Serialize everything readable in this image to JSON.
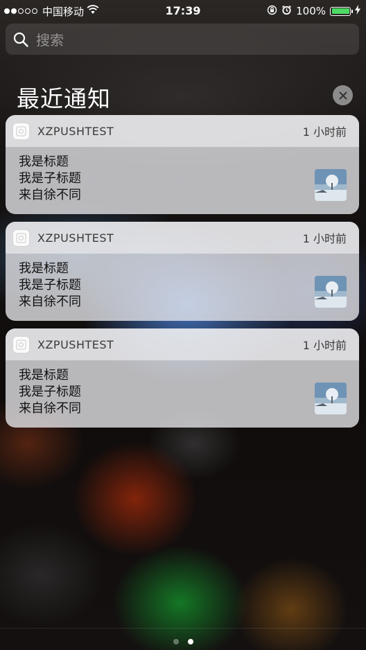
{
  "status_bar": {
    "carrier": "中国移动",
    "time": "17:39",
    "battery_percent": "100%",
    "signal_bars": 2,
    "signal_total": 5,
    "battery_color": "#4cd964"
  },
  "search": {
    "placeholder": "搜索"
  },
  "section": {
    "title": "最近通知"
  },
  "notifications": [
    {
      "app": "XZPUSHTEST",
      "time": "1 小时前",
      "title": "我是标题",
      "subtitle": "我是子标题",
      "body": "来自徐不同"
    },
    {
      "app": "XZPUSHTEST",
      "time": "1 小时前",
      "title": "我是标题",
      "subtitle": "我是子标题",
      "body": "来自徐不同"
    },
    {
      "app": "XZPUSHTEST",
      "time": "1 小时前",
      "title": "我是标题",
      "subtitle": "我是子标题",
      "body": "来自徐不同"
    }
  ],
  "page_indicator": {
    "count": 2,
    "active_index": 1
  },
  "icons": {
    "search": "search-icon",
    "clear": "close-icon",
    "wifi": "wifi-icon",
    "lock": "orientation-lock-icon",
    "alarm": "alarm-icon",
    "charging": "charging-bolt-icon"
  }
}
